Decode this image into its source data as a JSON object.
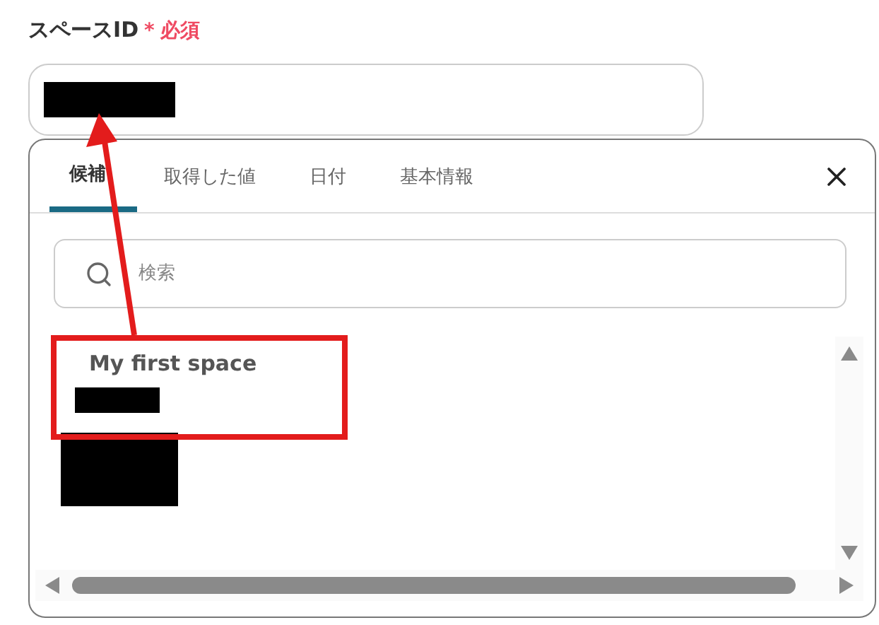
{
  "field": {
    "label": "スペースID",
    "required_mark": "*",
    "required_text": "必須"
  },
  "tabs": [
    {
      "label": "候補",
      "selected": true
    },
    {
      "label": "取得した値",
      "selected": false
    },
    {
      "label": "日付",
      "selected": false
    },
    {
      "label": "基本情報",
      "selected": false
    }
  ],
  "search": {
    "placeholder": "検索"
  },
  "options": [
    {
      "title": "My first space",
      "highlighted": true
    }
  ]
}
